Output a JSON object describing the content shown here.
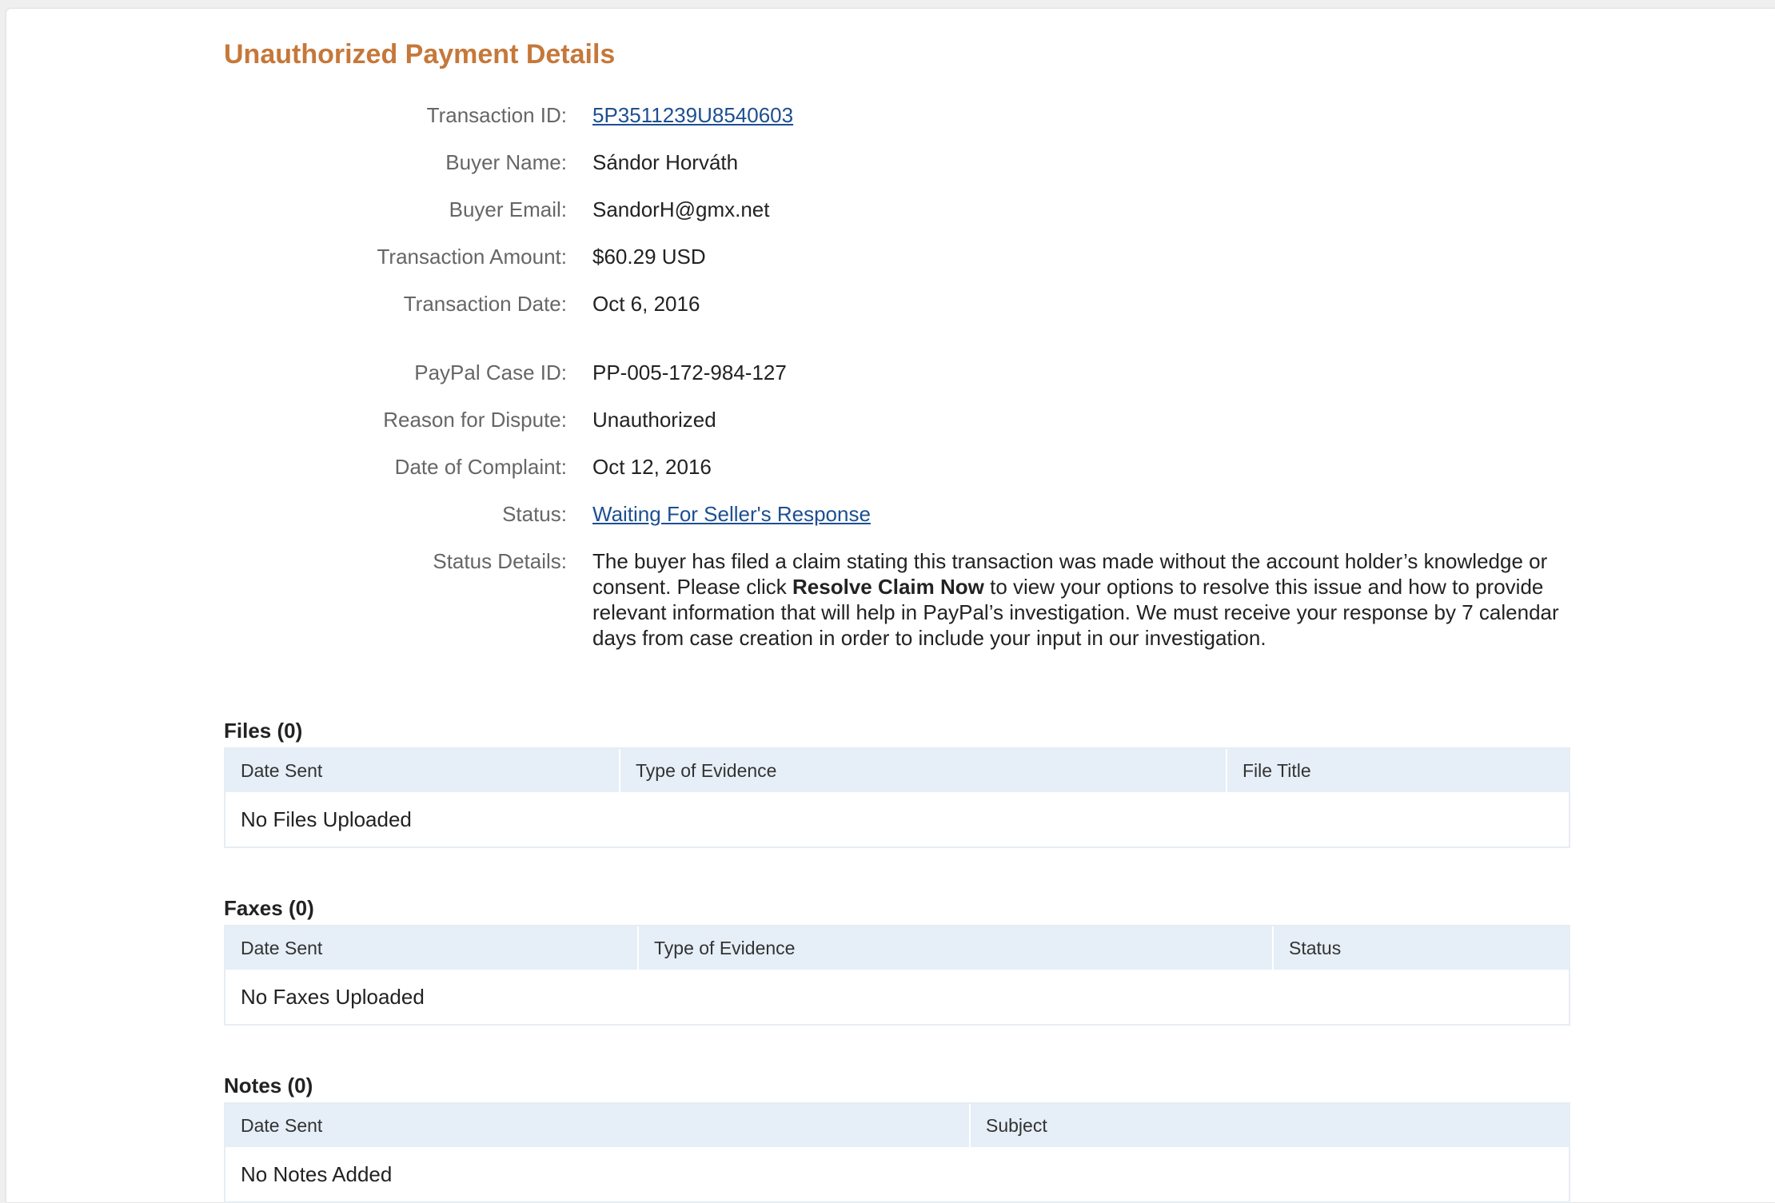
{
  "page": {
    "title": "Unauthorized Payment Details"
  },
  "details": {
    "transaction_id": {
      "label": "Transaction ID:",
      "value": "5P3511239U8540603"
    },
    "buyer_name": {
      "label": "Buyer Name:",
      "value": "Sándor Horváth"
    },
    "buyer_email": {
      "label": "Buyer Email:",
      "value": "SandorH@gmx.net"
    },
    "transaction_amount": {
      "label": "Transaction Amount:",
      "value": "$60.29 USD"
    },
    "transaction_date": {
      "label": "Transaction Date:",
      "value": "Oct 6, 2016"
    },
    "case_id": {
      "label": "PayPal Case ID:",
      "value": "PP-005-172-984-127"
    },
    "reason": {
      "label": "Reason for Dispute:",
      "value": "Unauthorized"
    },
    "complaint_date": {
      "label": "Date of Complaint:",
      "value": "Oct 12, 2016"
    },
    "status": {
      "label": "Status:",
      "value": "Waiting For Seller's Response"
    },
    "status_details": {
      "label": "Status Details:",
      "text_before": "The buyer has filed a claim stating this transaction was made without the account holder’s knowledge or consent. Please click ",
      "bold": "Resolve Claim Now",
      "text_after": " to view your options to resolve this issue and how to provide relevant information that will help in PayPal’s investigation. We must receive your response by 7 calendar days from case creation in order to include your input in our investigation."
    }
  },
  "files": {
    "title": "Files (0)",
    "columns": [
      "Date Sent",
      "Type of Evidence",
      "File Title"
    ],
    "empty": "No Files Uploaded"
  },
  "faxes": {
    "title": "Faxes (0)",
    "columns": [
      "Date Sent",
      "Type of Evidence",
      "Status"
    ],
    "empty": "No Faxes Uploaded"
  },
  "notes": {
    "title": "Notes (0)",
    "columns": [
      "Date Sent",
      "Subject"
    ],
    "empty": "No Notes Added"
  },
  "colors": {
    "title": "#c5783a",
    "link": "#1d4f91",
    "table_header": "#e6eef7"
  }
}
